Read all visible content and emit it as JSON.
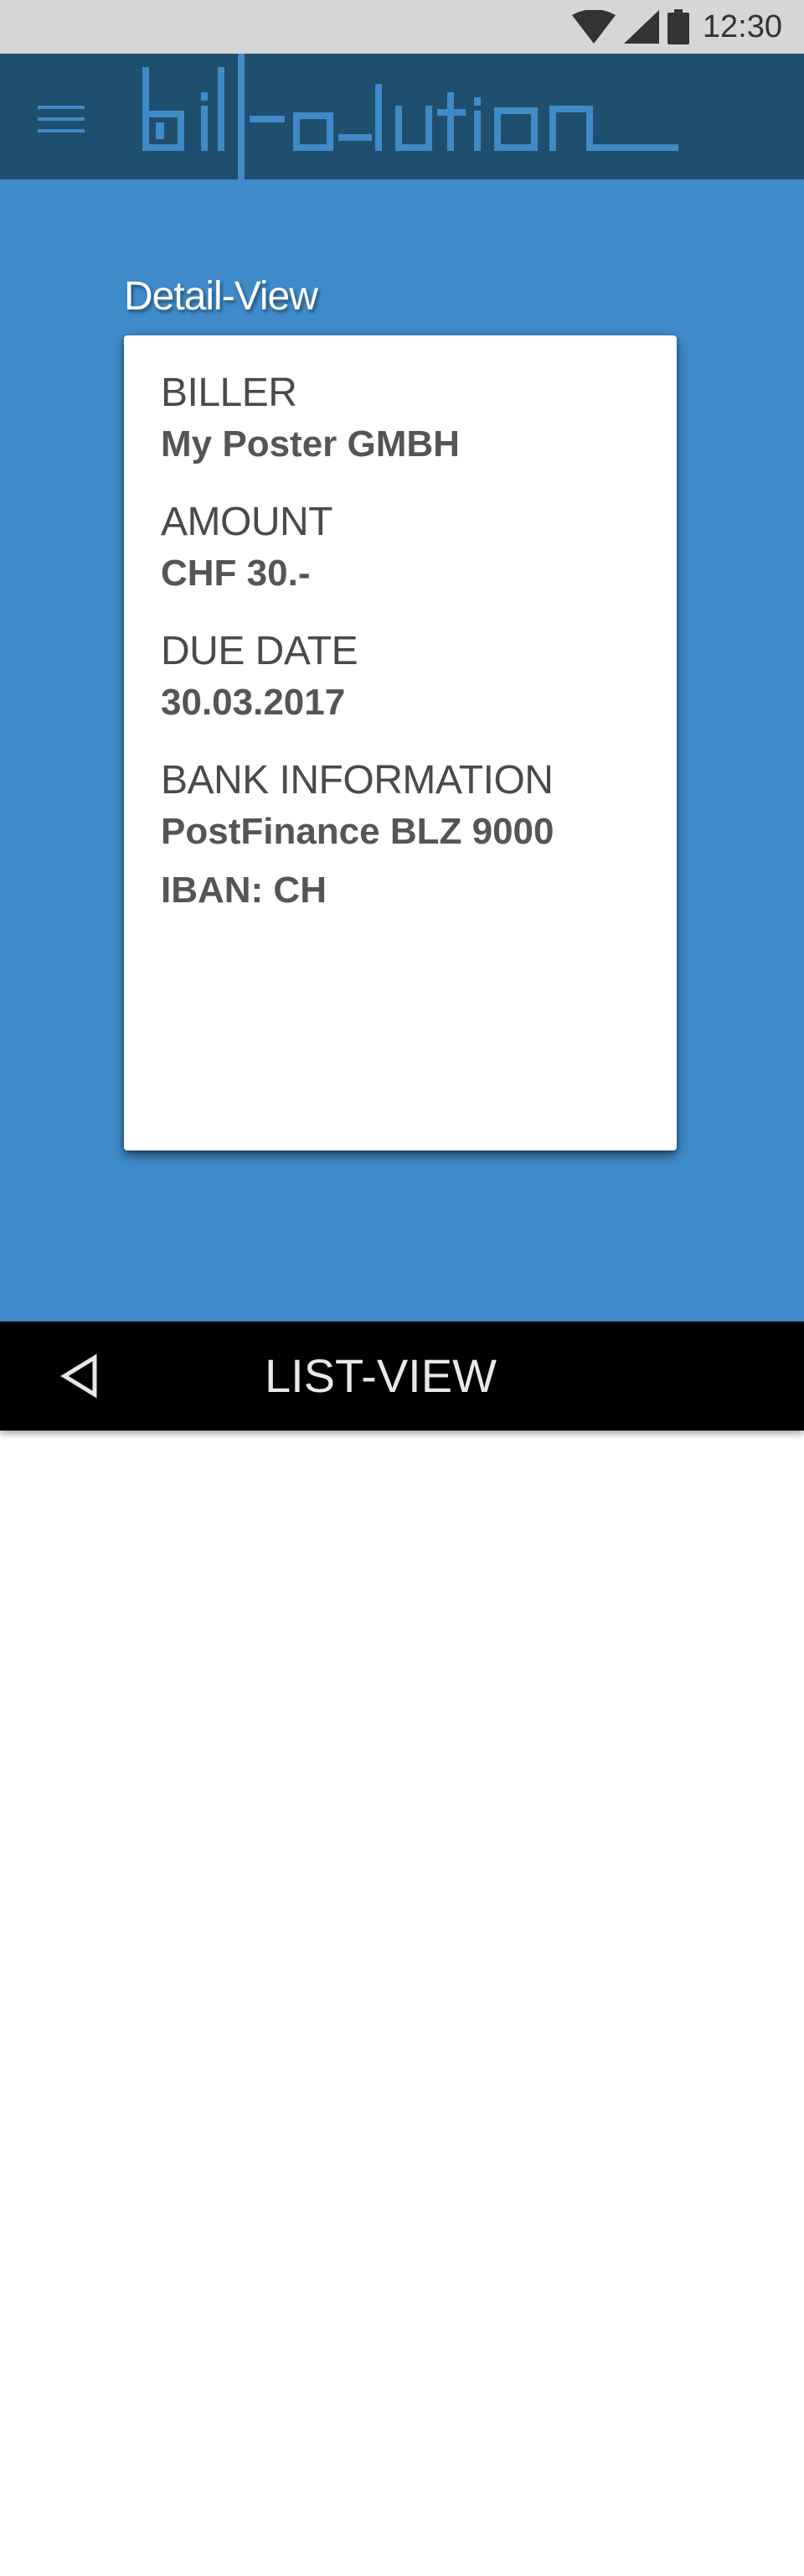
{
  "status_bar": {
    "time": "12:30",
    "icons": [
      "wifi-icon",
      "cellular-signal-icon",
      "battery-icon"
    ]
  },
  "app_bar": {
    "logo_text": "bill-o-lution",
    "menu_icon": "hamburger-menu-icon",
    "background": "#1f4f6e",
    "logo_color": "#3f8ac8"
  },
  "content": {
    "background": "#3f8ac8",
    "section_title": "Detail-View",
    "fields": {
      "biller": {
        "label": "BILLER",
        "value": "My Poster GMBH"
      },
      "amount": {
        "label": "AMOUNT",
        "value": "CHF 30.-"
      },
      "due_date": {
        "label": "DUE DATE",
        "value": "30.03.2017"
      },
      "bank": {
        "label": "BANK INFORMATION",
        "line1": "PostFinance BLZ 9000",
        "line2": "IBAN: CH"
      }
    }
  },
  "bottom_nav": {
    "back_icon": "back-triangle-icon",
    "label": "LIST-VIEW"
  }
}
